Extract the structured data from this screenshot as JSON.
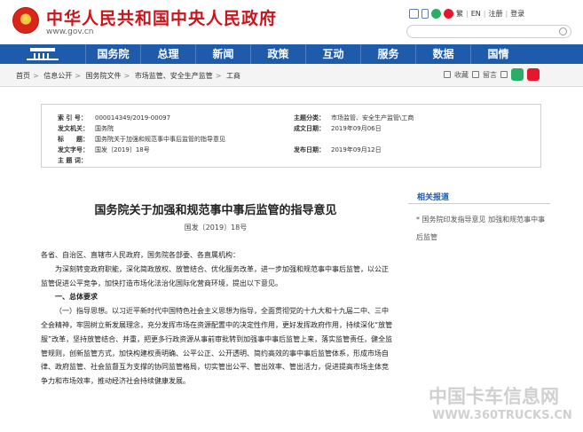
{
  "header": {
    "site_title": "中华人民共和国中央人民政府",
    "site_url": "www.gov.cn",
    "top_links": [
      "繁",
      "EN",
      "注册",
      "登录"
    ]
  },
  "nav": {
    "items": [
      "国务院",
      "总理",
      "新闻",
      "政策",
      "互动",
      "服务",
      "数据",
      "国情"
    ]
  },
  "breadcrumb": {
    "items": [
      "首页",
      "信息公开",
      "国务院文件",
      "市场监管、安全生产监管",
      "工商"
    ],
    "favorite": "收藏",
    "print": "留言"
  },
  "info": {
    "index_label": "索 引 号：",
    "index_value": "000014349/2019-00097",
    "org_label": "发文机关：",
    "org_value": "国务院",
    "title_label": "标　　题：",
    "title_value": "国务院关于加强和规范事中事后监管的指导意见",
    "docno_label": "发文字号：",
    "docno_value": "国发〔2019〕18号",
    "subject_label": "主 题 词：",
    "subject_value": "",
    "category_label": "主题分类：",
    "category_value": "市场监管、安全生产监管\\工商",
    "written_label": "成文日期：",
    "written_value": "2019年09月06日",
    "published_label": "发布日期：",
    "published_value": "2019年09月12日"
  },
  "document": {
    "title": "国务院关于加强和规范事中事后监管的指导意见",
    "number": "国发〔2019〕18号",
    "addressee": "各省、自治区、直辖市人民政府，国务院各部委、各直属机构：",
    "intro": "为深刻转变政府职能，深化简政放权、放管结合、优化服务改革，进一步加强和规范事中事后监管，以公正监管促进公平竞争，加快打造市场化法治化国际化营商环境，提出以下意见。",
    "section1": "一、总体要求",
    "para1": "（一）指导思想。以习近平新时代中国特色社会主义思想为指导，全面贯彻党的十九大和十九届二中、三中全会精神，牢固树立新发展理念，充分发挥市场在资源配置中的决定性作用，更好发挥政府作用，持续深化“放管服”改革，坚持放管结合、并重，把更多行政资源从事前审批转到加强事中事后监管上来，落实监管责任，健全监管规则，创新监管方式，加快构建权责明确、公平公正、公开透明、简约高效的事中事后监管体系，形成市场自律、政府监管、社会监督互为支撑的协同监管格局，切实管出公平、管出效率、管出活力，促进提高市场主体竞争力和市场效率，推动经济社会持续健康发展。"
  },
  "related": {
    "title": "相关报道",
    "items": [
      "* 国务院印发指导意见 加强和规范事中事后监管"
    ]
  },
  "watermark": {
    "cn": "中国卡车信息网",
    "en": "WWW.360TRUCKS.CN"
  }
}
